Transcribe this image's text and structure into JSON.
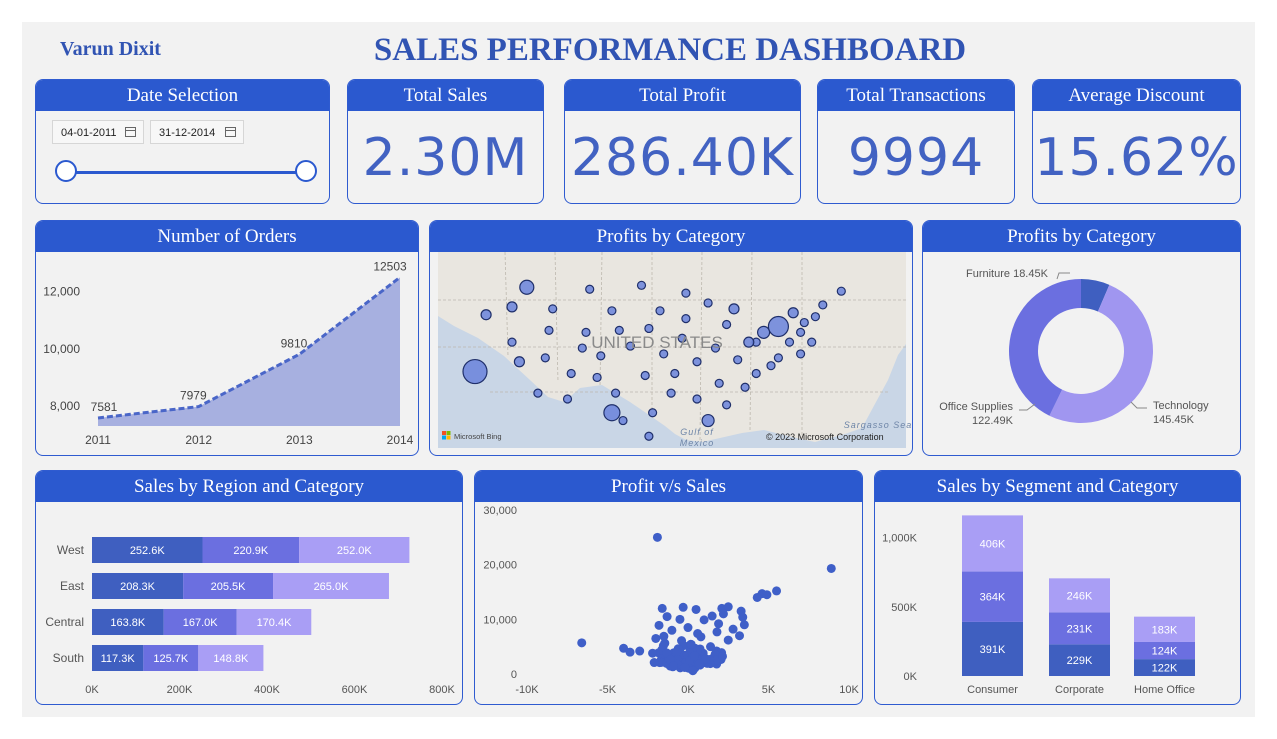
{
  "header": {
    "author": "Varun Dixit",
    "title": "SALES PERFORMANCE DASHBOARD"
  },
  "date_selection": {
    "title": "Date Selection",
    "start": "04-01-2011",
    "end": "31-12-2014"
  },
  "kpis": {
    "total_sales": {
      "label": "Total Sales",
      "value": "2.30M"
    },
    "total_profit": {
      "label": "Total Profit",
      "value": "286.40K"
    },
    "total_transactions": {
      "label": "Total Transactions",
      "value": "9994"
    },
    "average_discount": {
      "label": "Average Discount",
      "value": "15.62%"
    }
  },
  "map": {
    "title": "Profits by Category",
    "country_label": "UNITED STATES",
    "sea_label": "Sargasso Sea",
    "gulf_label_1": "Gulf of",
    "gulf_label_2": "Mexico",
    "copyright": "© 2023 Microsoft Corporation",
    "logo_text": "Microsoft Bing",
    "land_color": "#e9e6e0",
    "water_color": "#c9d6e6"
  },
  "colors": {
    "header": "#2b59cf",
    "dark": "#3f5fc0",
    "mid": "#6b6fe0",
    "light": "#a99ef5",
    "donut_light": "#a096f0",
    "text": "#555555"
  },
  "chart_data": [
    {
      "id": "orders",
      "type": "area",
      "title": "Number of Orders",
      "x": [
        2011,
        2012,
        2013,
        2014
      ],
      "xticks": [
        "2011",
        "2012",
        "2013",
        "2014"
      ],
      "values": [
        7581,
        7979,
        9810,
        12503
      ],
      "data_labels": [
        "7581",
        "7979",
        "9810",
        "12503"
      ],
      "yticks": [
        8000,
        10000,
        12000
      ],
      "ytick_labels": [
        "8,000",
        "10,000",
        "12,000"
      ],
      "ylim": [
        7300,
        12900
      ],
      "grid": false
    },
    {
      "id": "donut",
      "type": "pie",
      "title": "Profits by Category",
      "labels": [
        "Furniture",
        "Technology",
        "Office Supplies"
      ],
      "values": [
        18.45,
        145.45,
        122.49
      ],
      "value_labels": [
        "18.45K",
        "145.45K",
        "122.49K"
      ],
      "colors": [
        "#3f5fc0",
        "#a096f0",
        "#6b6fe0"
      ]
    },
    {
      "id": "region",
      "type": "bar",
      "orientation": "horizontal",
      "stacked": true,
      "title": "Sales by Region and Category",
      "categories": [
        "West",
        "East",
        "Central",
        "South"
      ],
      "series": [
        {
          "values": [
            252.6,
            208.3,
            163.8,
            117.3
          ],
          "labels": [
            "252.6K",
            "208.3K",
            "163.8K",
            "117.3K"
          ],
          "color": "#3f5fc0"
        },
        {
          "values": [
            220.9,
            205.5,
            167.0,
            125.7
          ],
          "labels": [
            "220.9K",
            "205.5K",
            "167.0K",
            "125.7K"
          ],
          "color": "#6b6fe0"
        },
        {
          "values": [
            252.0,
            265.0,
            170.4,
            148.8
          ],
          "labels": [
            "252.0K",
            "265.0K",
            "170.4K",
            "148.8K"
          ],
          "color": "#a99ef5"
        }
      ],
      "xticks": [
        0,
        200,
        400,
        600,
        800
      ],
      "xtick_labels": [
        "0K",
        "200K",
        "400K",
        "600K",
        "800K"
      ],
      "xlim": [
        0,
        800
      ]
    },
    {
      "id": "scatter",
      "type": "scatter",
      "title": "Profit v/s Sales",
      "xticks": [
        -10,
        -5,
        0,
        5,
        10
      ],
      "xtick_labels": [
        "-10K",
        "-5K",
        "0K",
        "5K",
        "10K"
      ],
      "yticks": [
        0,
        10000,
        20000,
        30000
      ],
      "ytick_labels": [
        "0",
        "10,000",
        "20,000",
        "30,000"
      ],
      "xlim": [
        -10,
        10
      ],
      "ylim": [
        0,
        30000
      ],
      "points": [
        [
          -1.9,
          25000
        ],
        [
          8.9,
          19300
        ],
        [
          5.5,
          15200
        ],
        [
          4.6,
          14700
        ],
        [
          4.3,
          14000
        ],
        [
          4.9,
          14500
        ],
        [
          -1.6,
          12000
        ],
        [
          -0.3,
          12200
        ],
        [
          0.5,
          11800
        ],
        [
          2.1,
          12000
        ],
        [
          2.5,
          12300
        ],
        [
          3.3,
          11500
        ],
        [
          -6.6,
          5700
        ],
        [
          -2.0,
          6500
        ],
        [
          -1.5,
          6900
        ],
        [
          -1.8,
          8900
        ],
        [
          -4.0,
          4700
        ],
        [
          -3.6,
          4000
        ],
        [
          -3.0,
          4200
        ],
        [
          -2.2,
          3800
        ],
        [
          -2.1,
          2100
        ],
        [
          -1.1,
          2600
        ],
        [
          3.5,
          9000
        ],
        [
          2.8,
          8200
        ],
        [
          3.2,
          7000
        ],
        [
          2.5,
          6200
        ],
        [
          3.4,
          10400
        ],
        [
          1.5,
          10600
        ],
        [
          1.0,
          9900
        ],
        [
          -0.5,
          10000
        ],
        [
          -1.0,
          8000
        ],
        [
          0.2,
          5400
        ],
        [
          0.8,
          6800
        ],
        [
          1.8,
          7700
        ],
        [
          1.4,
          5000
        ],
        [
          -0.7,
          4100
        ],
        [
          0.4,
          3300
        ],
        [
          1.1,
          2800
        ],
        [
          0.7,
          1800
        ],
        [
          -0.2,
          1200
        ],
        [
          0.3,
          600
        ],
        [
          -0.9,
          1500
        ],
        [
          0.6,
          7400
        ],
        [
          -0.4,
          6100
        ],
        [
          1.9,
          9200
        ],
        [
          2.2,
          11000
        ],
        [
          0.0,
          8500
        ],
        [
          -1.3,
          10500
        ]
      ],
      "cluster": {
        "center": [
          0.2,
          2500
        ],
        "count": 120
      }
    },
    {
      "id": "segment",
      "type": "bar",
      "orientation": "vertical",
      "stacked": true,
      "title": "Sales by Segment and Category",
      "categories": [
        "Consumer",
        "Corporate",
        "Home Office"
      ],
      "series": [
        {
          "values": [
            391,
            229,
            122
          ],
          "labels": [
            "391K",
            "229K",
            "122K"
          ],
          "color": "#3f5fc0"
        },
        {
          "values": [
            364,
            231,
            124
          ],
          "labels": [
            "364K",
            "231K",
            "124K"
          ],
          "color": "#6b6fe0"
        },
        {
          "values": [
            406,
            246,
            183
          ],
          "labels": [
            "406K",
            "246K",
            "183K"
          ],
          "color": "#a99ef5"
        }
      ],
      "yticks": [
        0,
        500,
        1000
      ],
      "ytick_labels": [
        "0K",
        "500K",
        "1,000K"
      ],
      "ylim": [
        0,
        1200
      ]
    },
    {
      "id": "bubbles",
      "type": "scatter",
      "title": "Profits by Category",
      "points": [
        [
          0.24,
          0.18,
          7
        ],
        [
          0.2,
          0.28,
          5
        ],
        [
          0.31,
          0.29,
          4
        ],
        [
          0.41,
          0.19,
          4
        ],
        [
          0.55,
          0.17,
          4
        ],
        [
          0.67,
          0.21,
          4
        ],
        [
          0.73,
          0.26,
          4
        ],
        [
          0.8,
          0.29,
          5
        ],
        [
          0.3,
          0.4,
          4
        ],
        [
          0.2,
          0.46,
          4
        ],
        [
          0.13,
          0.32,
          5
        ],
        [
          0.22,
          0.56,
          5
        ],
        [
          0.1,
          0.61,
          12
        ],
        [
          0.29,
          0.54,
          4
        ],
        [
          0.39,
          0.49,
          4
        ],
        [
          0.52,
          0.48,
          4
        ],
        [
          0.61,
          0.52,
          4
        ],
        [
          0.7,
          0.56,
          4
        ],
        [
          0.56,
          0.63,
          4
        ],
        [
          0.63,
          0.72,
          4
        ],
        [
          0.7,
          0.75,
          4
        ],
        [
          0.76,
          0.67,
          4
        ],
        [
          0.81,
          0.55,
          4
        ],
        [
          0.86,
          0.46,
          4
        ],
        [
          0.88,
          0.41,
          6
        ],
        [
          0.92,
          0.38,
          10
        ],
        [
          0.95,
          0.46,
          4
        ],
        [
          0.98,
          0.52,
          4
        ],
        [
          0.96,
          0.31,
          5
        ],
        [
          0.99,
          0.36,
          4
        ],
        [
          1.02,
          0.33,
          4
        ],
        [
          0.98,
          0.41,
          4
        ],
        [
          1.01,
          0.46,
          4
        ],
        [
          0.9,
          0.58,
          4
        ],
        [
          0.86,
          0.62,
          4
        ],
        [
          0.83,
          0.69,
          4
        ],
        [
          0.78,
          0.78,
          4
        ],
        [
          0.73,
          0.86,
          6
        ],
        [
          0.58,
          0.82,
          4
        ],
        [
          0.48,
          0.72,
          4
        ],
        [
          0.43,
          0.64,
          4
        ],
        [
          0.36,
          0.62,
          4
        ],
        [
          0.64,
          0.62,
          4
        ],
        [
          0.4,
          0.41,
          4
        ],
        [
          0.49,
          0.4,
          4
        ],
        [
          0.57,
          0.39,
          4
        ],
        [
          0.66,
          0.44,
          4
        ],
        [
          0.75,
          0.49,
          4
        ],
        [
          0.47,
          0.3,
          4
        ],
        [
          0.27,
          0.72,
          4
        ],
        [
          0.35,
          0.75,
          4
        ],
        [
          0.5,
          0.86,
          4
        ],
        [
          0.57,
          0.94,
          4
        ],
        [
          0.84,
          0.46,
          5
        ],
        [
          0.92,
          0.54,
          4
        ],
        [
          1.04,
          0.27,
          4
        ],
        [
          1.09,
          0.2,
          4
        ],
        [
          0.67,
          0.34,
          4
        ],
        [
          0.6,
          0.3,
          4
        ],
        [
          0.78,
          0.37,
          4
        ],
        [
          0.44,
          0.53,
          4
        ],
        [
          0.47,
          0.82,
          8
        ]
      ]
    }
  ]
}
